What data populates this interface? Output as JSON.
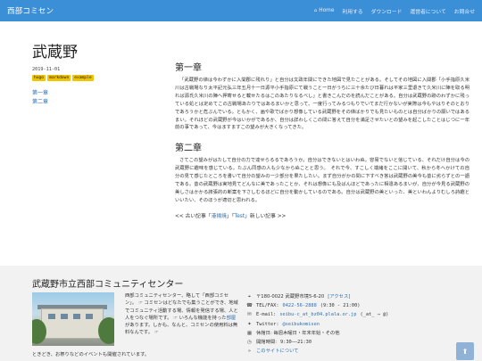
{
  "nav": {
    "brand": "西部コミセン",
    "links": [
      {
        "icon": "home-icon",
        "glyph": "⌂",
        "label": "Home"
      },
      {
        "label": "利用する"
      },
      {
        "label": "ダウンロード"
      },
      {
        "label": "運営者について"
      },
      {
        "label": "お問合せ"
      }
    ]
  },
  "article": {
    "title": "武蔵野",
    "date": "2019-11-01",
    "tags": [
      "hugo",
      "markdown",
      "example"
    ],
    "toc": [
      "第一章",
      "第二章"
    ],
    "chapter1_heading": "第一章",
    "chapter1_text": "「武蔵野の俤は今わずかに入間郡に残れり」と自分は文政年間にできた地図で見たことがある。そしてその地図に入間郡「小手指原久米川は古戦場なり太平記元弘三年五月十一日源平小手指原にて戦うこと一日がうちに三十余たび日暮れは平家三里退きて久米川に陣を取る明れば源氏久米川の陣へ押寄せると載せたるはこのあたりなるべし」と書きこんだのを読んだことがある。自分は武蔵野の跡のわずかに残っている処とは定めてこの古戦場あたりではあるまいかと思って、一度行ってみるつもりでいてまだ行かないが実際は今もやはりそのとおりであろうかと危ぶんでいる。ともかく、画や歌でばかり想像している武蔵野をその俤ばかりでも見たいものとは自分ばかりの願いではあるまい。それほどの武蔵野が今はいかがであるか、自分は詳わしくこの問に答えて自分を満足させたいとの望みを起こしたことはじつに一年前の事であって、今はますますこの望みが大きくなってきた。",
    "chapter2_heading": "第二章",
    "chapter2_text": "さてこの望みがはたして自分の力で達せらるるであろうか。自分はできないとはいわぬ。容易でないと信じている、それだけ自分は今の武蔵野に趣味を感じている。たぶん同感の人も少なからぬことと思う。　それで今、すこしく端緒をここに開いて、秋から冬へかけての自分の見て感じたところを書いて自分の望みの一少部分を果たしたい。まず自分がかの問に下すべき答は武蔵野の美今も昔に劣らずとの一語である。昔の武蔵野は実地見てどんなに美であったことか、それは想像にも及ばんほどであったに相違あるまいが、自分が今見る武蔵野の美しさはかかる誇張的の断案を下さしむるほどに自分を動かしているのである。自分は武蔵野の美といった、美といわんよりむしろ詩趣といいたい、そのほうが適切と思われる。",
    "pager_prefix": "<< 古い記事「",
    "pager_prev": "港揚焼",
    "pager_mid": "」「",
    "pager_next": "Test",
    "pager_suffix": "」新しい記事 >>"
  },
  "footer": {
    "title": "武蔵野市立西部コミュニティセンター",
    "desc_1": "西部コミュニティセンター、略して「西部コミセン」。",
    "desc_2": "コミセンはどなたでも集うことができ、地域でコミュニティ活動する場、情報を発信する場、人と人をつなぐ場所です。",
    "desc_3": "いろんな機能を持った",
    "desc_link": "部屋",
    "desc_4": "があります。しかも、なんと、コミセンの使用料は無料なんです。",
    "desc_tail": "ときどき、お祭りなどのイベントも開催されています。",
    "address": "〒180-0022 武蔵野市境5-6-20",
    "access": "[アクセス]",
    "tel_label": "TEL/FAX:",
    "tel": "0422-56-2888",
    "tel_hours": "(9:30 - 21:00)",
    "email_label": "E-mail:",
    "email": "seibu-c_at_bz04.plala.or.jp",
    "email_note": "(_at_ → @)",
    "twitter_label": "Twitter:",
    "twitter": "@seibukomisen",
    "closed": "休館日: 毎週木曜日・年末年始・その他",
    "hours_label": "開館時間:",
    "hours": "9:30――21:30",
    "site_link": "このサイトについて"
  },
  "scroll_top": "⬆"
}
